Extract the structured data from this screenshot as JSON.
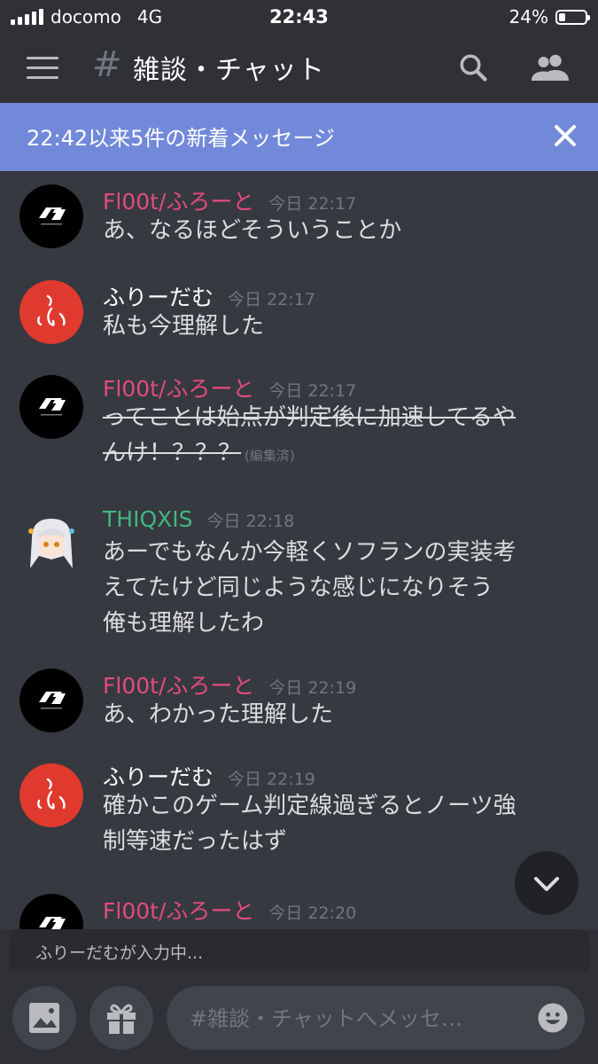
{
  "status_bar": {
    "carrier": "docomo",
    "network": "4G",
    "time": "22:43",
    "battery": "24%",
    "battery_level": 0.24
  },
  "header": {
    "hash": "#",
    "channel": "雑談・チャット"
  },
  "banner": {
    "text": "22:42以来5件の新着メッセージ"
  },
  "colors": {
    "float_author": "#e24c7d",
    "thiq_author": "#43b581",
    "furi_author": "#ffffff",
    "banner": "#7289da"
  },
  "messages": [
    {
      "author": "Fl00t/ふろーと",
      "time": "今日 22:17",
      "lines": [
        "あ、なるほどそういうことか"
      ]
    },
    {
      "author": "ふりーだむ",
      "time": "今日 22:17",
      "lines": [
        "私も今理解した"
      ]
    },
    {
      "author": "Fl00t/ふろーと",
      "time": "今日 22:17",
      "lines": [
        "ってことは始点が判定後に加速してるや",
        "んけ！？？？"
      ],
      "edited": "(編集済)"
    },
    {
      "author": "THIQXIS",
      "time": "今日 22:18",
      "lines": [
        "あーでもなんか今軽くソフランの実装考",
        "えてたけど同じような感じになりそう",
        "俺も理解したわ"
      ]
    },
    {
      "author": "Fl00t/ふろーと",
      "time": "今日 22:19",
      "lines": [
        "あ、わかった理解した"
      ]
    },
    {
      "author": "ふりーだむ",
      "time": "今日 22:19",
      "lines": [
        "確かこのゲーム判定線過ぎるとノーツ強",
        "制等速だったはず"
      ]
    },
    {
      "author": "Fl00t/ふろーと",
      "time": "今日 22:20",
      "lines": []
    }
  ],
  "typing": {
    "text": "ふりーだむが入力中..."
  },
  "composer": {
    "placeholder": "#雑談・チャットへメッセ…"
  }
}
